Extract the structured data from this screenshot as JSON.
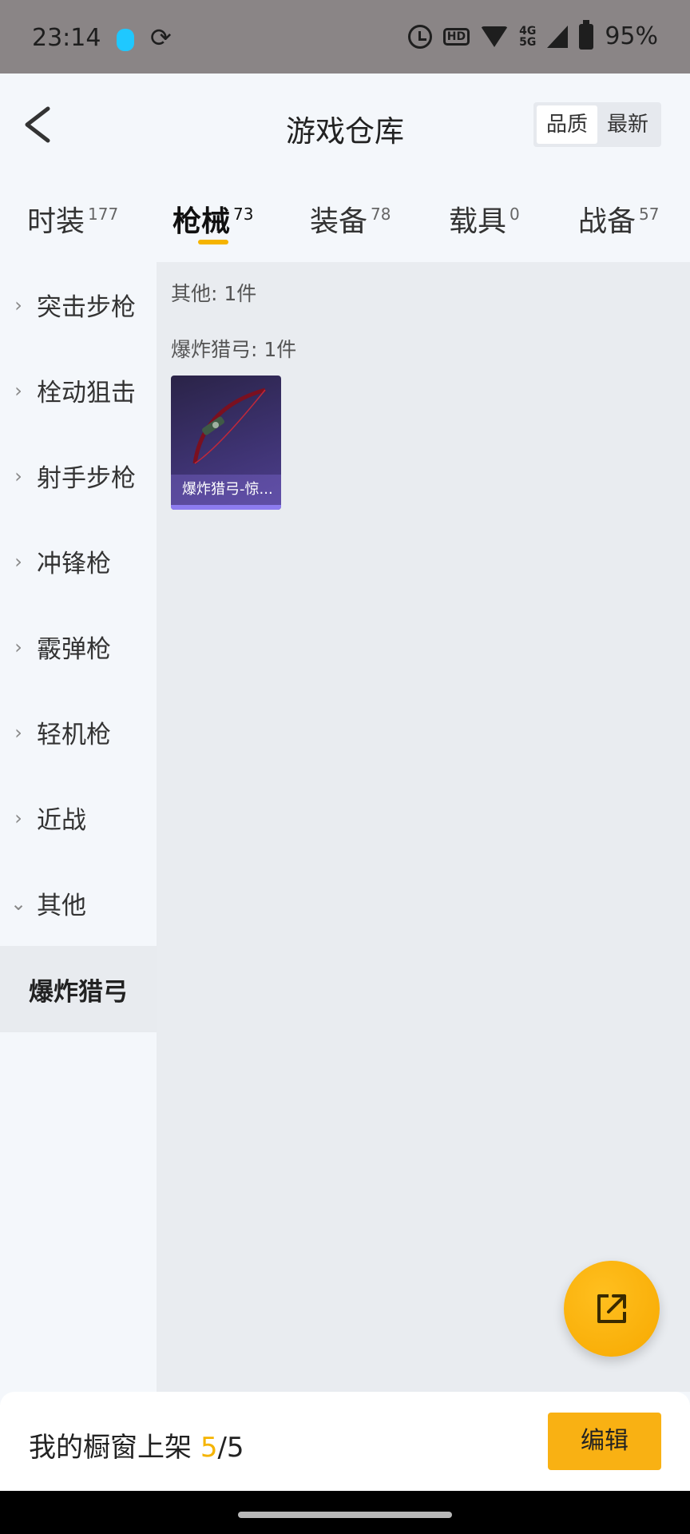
{
  "status_bar": {
    "time": "23:14",
    "network": "4G",
    "network2": "5G",
    "hd": "HD",
    "battery": "95%"
  },
  "header": {
    "title": "游戏仓库",
    "sort_options": [
      "品质",
      "最新"
    ],
    "active_sort": "品质"
  },
  "tabs": [
    {
      "label": "时装",
      "count": "177"
    },
    {
      "label": "枪械",
      "count": "73"
    },
    {
      "label": "装备",
      "count": "78"
    },
    {
      "label": "载具",
      "count": "0"
    },
    {
      "label": "战备",
      "count": "57"
    }
  ],
  "active_tab": "枪械",
  "sidebar": {
    "categories": [
      {
        "label": "突击步枪",
        "chevron": "›"
      },
      {
        "label": "栓动狙击",
        "chevron": "›"
      },
      {
        "label": "射手步枪",
        "chevron": "›"
      },
      {
        "label": "冲锋枪",
        "chevron": "›"
      },
      {
        "label": "霰弹枪",
        "chevron": "›"
      },
      {
        "label": "轻机枪",
        "chevron": "›"
      },
      {
        "label": "近战",
        "chevron": "›"
      },
      {
        "label": "其他",
        "chevron": "⌄"
      }
    ],
    "selected_subcategory": "爆炸猎弓"
  },
  "content": {
    "group_label": "其他: 1件",
    "subgroup_label": "爆炸猎弓: 1件",
    "items": [
      {
        "name": "爆炸猎弓-惊...",
        "icon": "bow-icon"
      }
    ]
  },
  "bottom_bar": {
    "shelf_label": "我的橱窗上架",
    "shelf_count": "5",
    "shelf_total": "/5",
    "edit_label": "编辑"
  },
  "colors": {
    "accent": "#f5b400",
    "fab": "#f7a900",
    "card_bg": "#3d3270",
    "status_bar": "#8a8586"
  }
}
